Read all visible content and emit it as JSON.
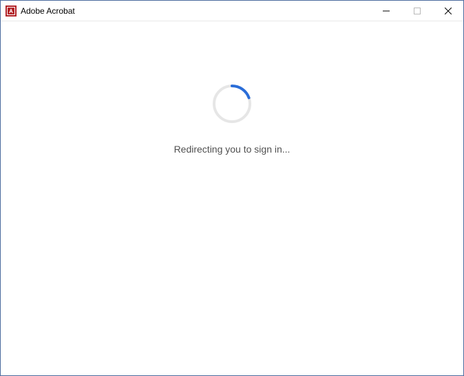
{
  "window": {
    "title": "Adobe Acrobat"
  },
  "main": {
    "status_text": "Redirecting you to sign in..."
  },
  "icons": {
    "app": "acrobat-icon",
    "minimize": "minimize-icon",
    "maximize": "maximize-icon",
    "close": "close-icon"
  },
  "colors": {
    "accent": "#2a6dd8",
    "spinner_track": "#e6e6e6",
    "brand_red": "#b11f24"
  }
}
